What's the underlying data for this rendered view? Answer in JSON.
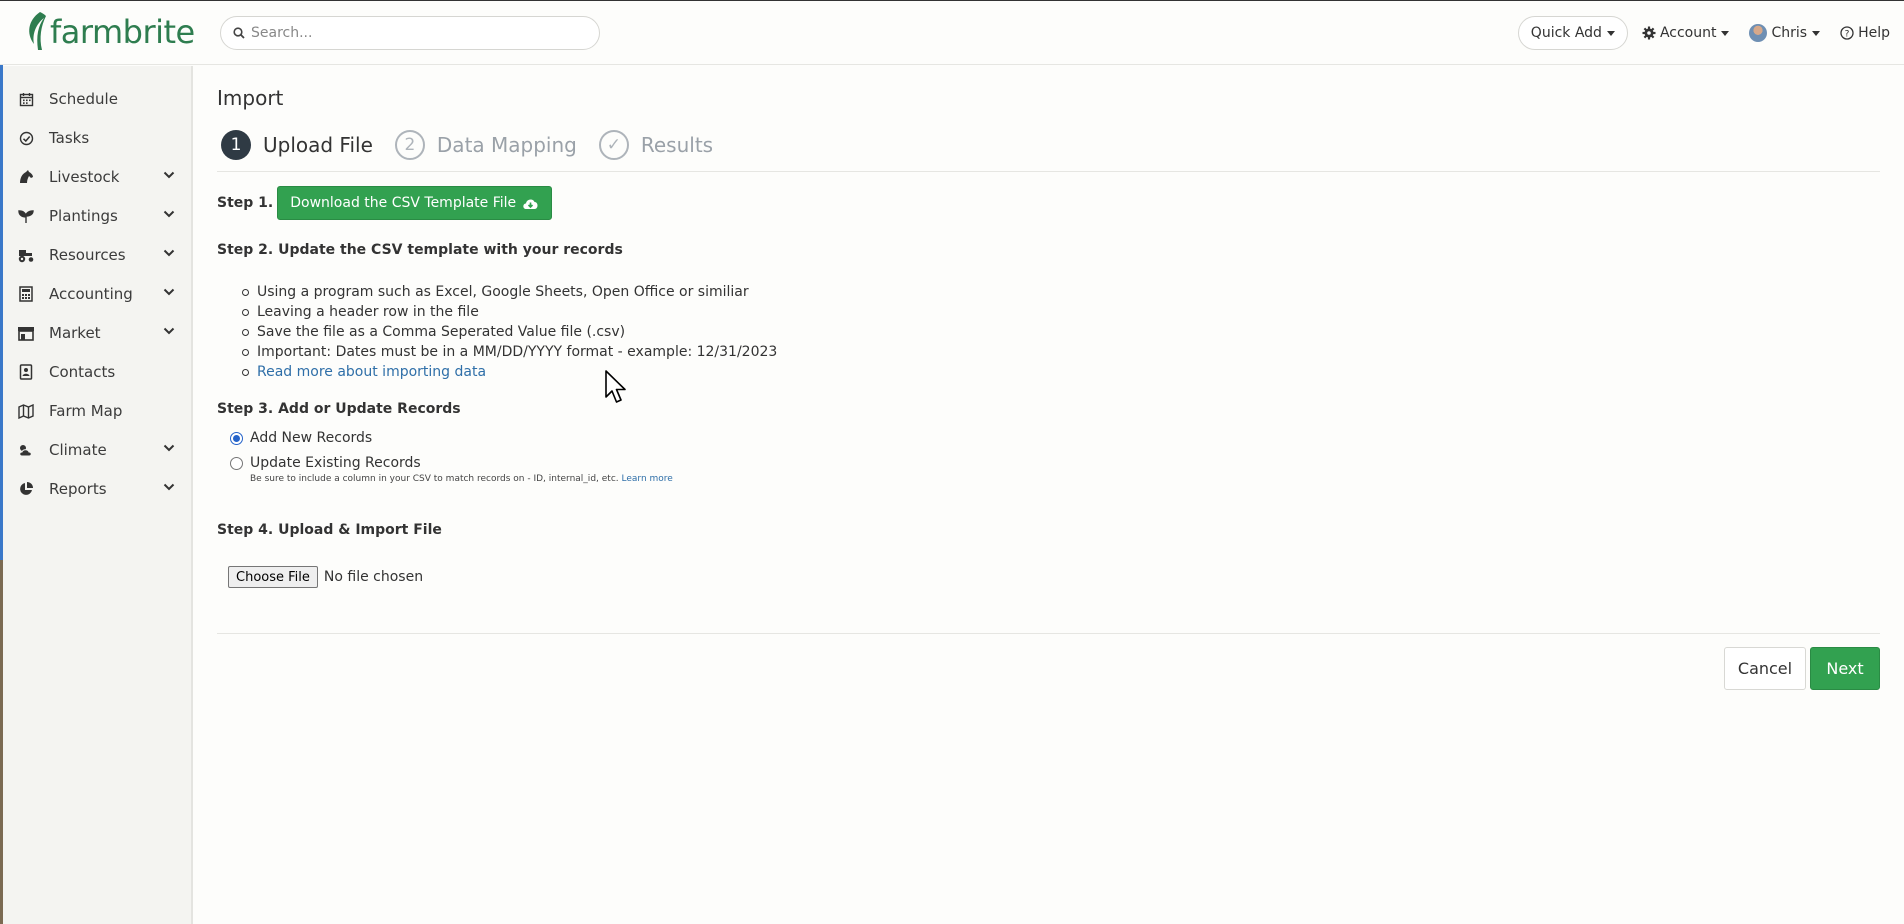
{
  "brand": {
    "name": "farmbrite",
    "color": "#2e7d4f"
  },
  "search": {
    "placeholder": "Search..."
  },
  "topnav": {
    "quick_add": "Quick Add",
    "account": "Account",
    "user": "Chris",
    "help": "Help"
  },
  "sidebar": {
    "items": [
      {
        "label": "Schedule",
        "icon": "calendar-icon",
        "has_children": false
      },
      {
        "label": "Tasks",
        "icon": "check-circle-icon",
        "has_children": false
      },
      {
        "label": "Livestock",
        "icon": "horse-icon",
        "has_children": true
      },
      {
        "label": "Plantings",
        "icon": "seedling-icon",
        "has_children": true
      },
      {
        "label": "Resources",
        "icon": "tractor-icon",
        "has_children": true
      },
      {
        "label": "Accounting",
        "icon": "calculator-icon",
        "has_children": true
      },
      {
        "label": "Market",
        "icon": "store-icon",
        "has_children": true
      },
      {
        "label": "Contacts",
        "icon": "address-book-icon",
        "has_children": false
      },
      {
        "label": "Farm Map",
        "icon": "map-icon",
        "has_children": false
      },
      {
        "label": "Climate",
        "icon": "cloud-sun-icon",
        "has_children": true
      },
      {
        "label": "Reports",
        "icon": "pie-chart-icon",
        "has_children": true
      }
    ]
  },
  "page": {
    "title": "Import",
    "wizard_steps": [
      {
        "number": "1",
        "label": "Upload File",
        "state": "active"
      },
      {
        "number": "2",
        "label": "Data Mapping",
        "state": "inactive"
      },
      {
        "number": "✓",
        "label": "Results",
        "state": "inactive"
      }
    ],
    "step1": {
      "label": "Step 1.",
      "button": "Download the CSV Template File"
    },
    "step2": {
      "label": "Step 2. Update the CSV template with your records",
      "bullets": [
        "Using a program such as Excel, Google Sheets, Open Office or similiar",
        "Leaving a header row in the file",
        "Save the file as a Comma Seperated Value file (.csv)",
        "Important: Dates must be in a MM/DD/YYYY format - example: 12/31/2023"
      ],
      "link": "Read more about importing data"
    },
    "step3": {
      "label": "Step 3. Add or Update Records",
      "option_add": "Add New Records",
      "option_update": "Update Existing Records",
      "selected": "Add New Records",
      "help_text": "Be sure to include a column in your CSV to match records on - ID, internal_id, etc.",
      "help_link": "Learn more"
    },
    "step4": {
      "label": "Step 4. Upload & Import File",
      "choose_button": "Choose File",
      "file_status": "No file chosen"
    },
    "actions": {
      "cancel": "Cancel",
      "next": "Next"
    }
  },
  "colors": {
    "primary_green": "#32a150",
    "link_blue": "#2f6fa8",
    "dark_step": "#2f3a44"
  }
}
